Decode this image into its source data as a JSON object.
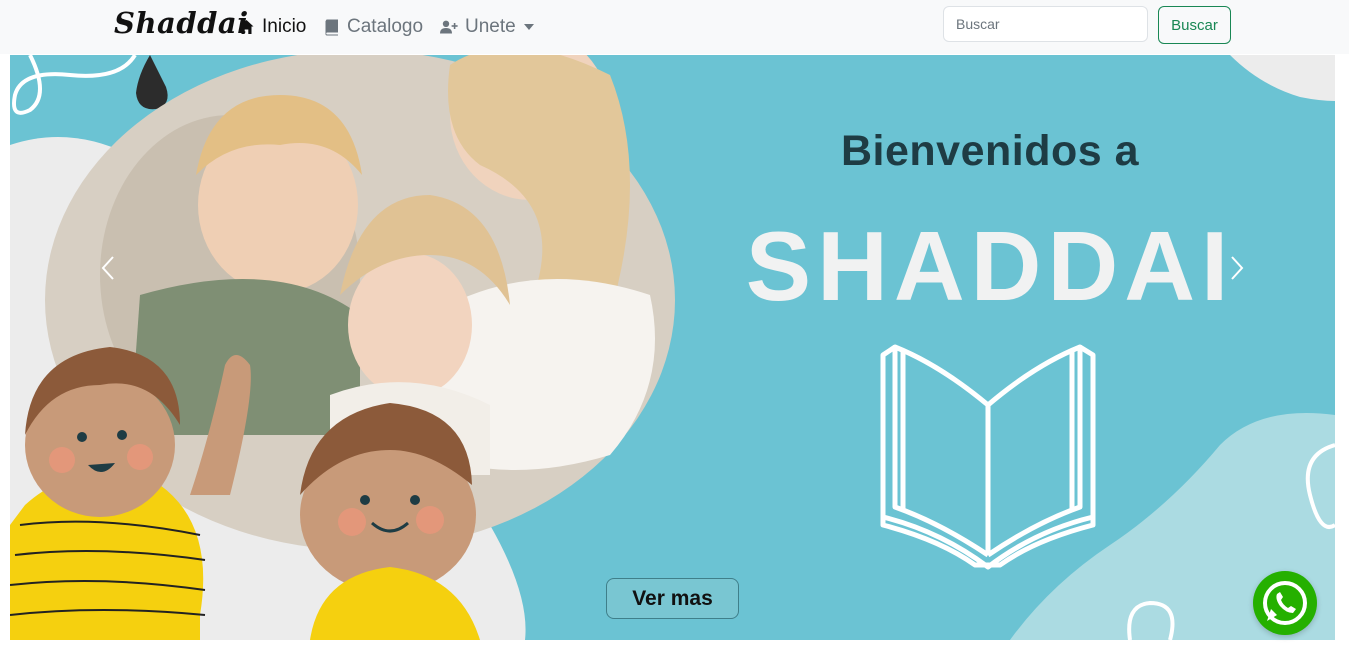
{
  "navbar": {
    "brand": "Shaddai",
    "links": [
      {
        "label": "Inicio",
        "icon": "house-icon",
        "active": true
      },
      {
        "label": "Catalogo",
        "icon": "book-icon",
        "active": false
      },
      {
        "label": "Unete",
        "icon": "person-plus-icon",
        "active": false,
        "dropdown": true
      }
    ],
    "search": {
      "placeholder": "Buscar",
      "value": ""
    },
    "search_button": "Buscar"
  },
  "hero": {
    "welcome_text": "Bienvenidos a",
    "title": "SHADDAI",
    "cta_label": "Ver mas",
    "prev_icon": "chevron-left-icon",
    "next_icon": "chevron-right-icon"
  },
  "floating": {
    "whatsapp_icon": "whatsapp-icon"
  },
  "colors": {
    "navbar_bg": "#f8f9fa",
    "hero_bg": "#6bc3d3",
    "title_dark": "#1e3c44",
    "search_green": "#198754",
    "whatsapp_green": "#25b000",
    "kid_shirt_yellow": "#f5d00f"
  }
}
